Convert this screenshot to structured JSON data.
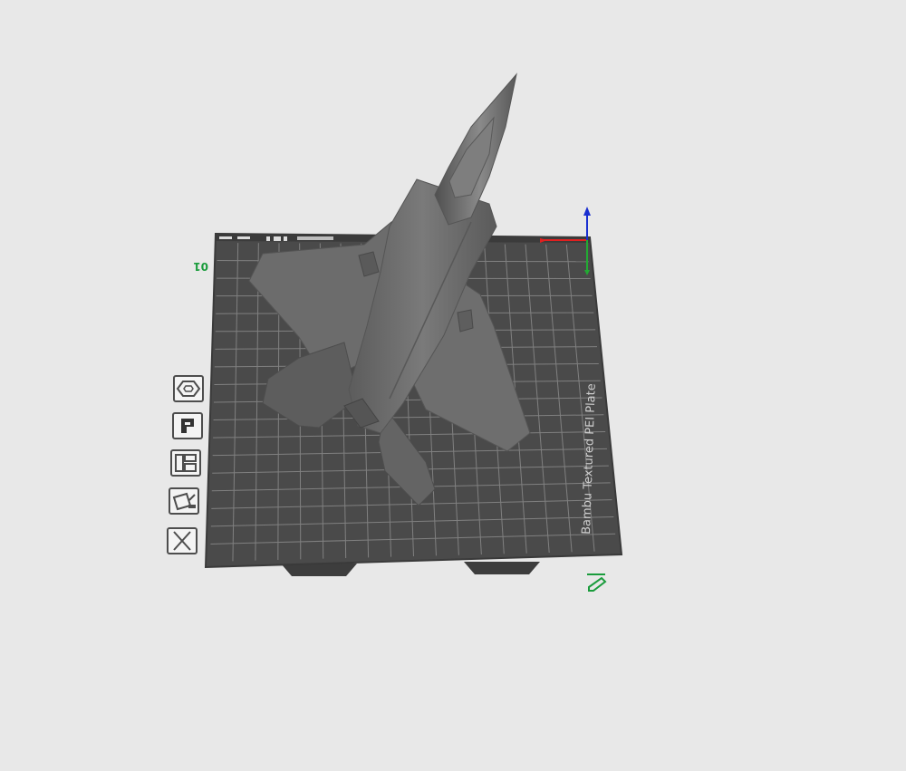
{
  "plate": {
    "label": "Bambu Textured PEI Plate",
    "number": "01"
  },
  "axes": {
    "x_color": "#e02020",
    "y_color": "#22aa33",
    "z_color": "#1a2fd0"
  },
  "model": {
    "color": "#6f6f6f"
  },
  "plate_toolbar": [
    {
      "name": "auto-orient",
      "icon": "hexagon-nut-icon"
    },
    {
      "name": "plate-settings",
      "icon": "plate-settings-icon"
    },
    {
      "name": "arrange",
      "icon": "arrange-icon"
    },
    {
      "name": "slice-plate",
      "icon": "slice-plate-icon"
    },
    {
      "name": "delete-plate",
      "icon": "close-icon"
    }
  ],
  "colors": {
    "background": "#e8e8e8",
    "plate": "#4a4a4a",
    "grid": "#8a8a8a",
    "accent": "#1a9c3c"
  }
}
